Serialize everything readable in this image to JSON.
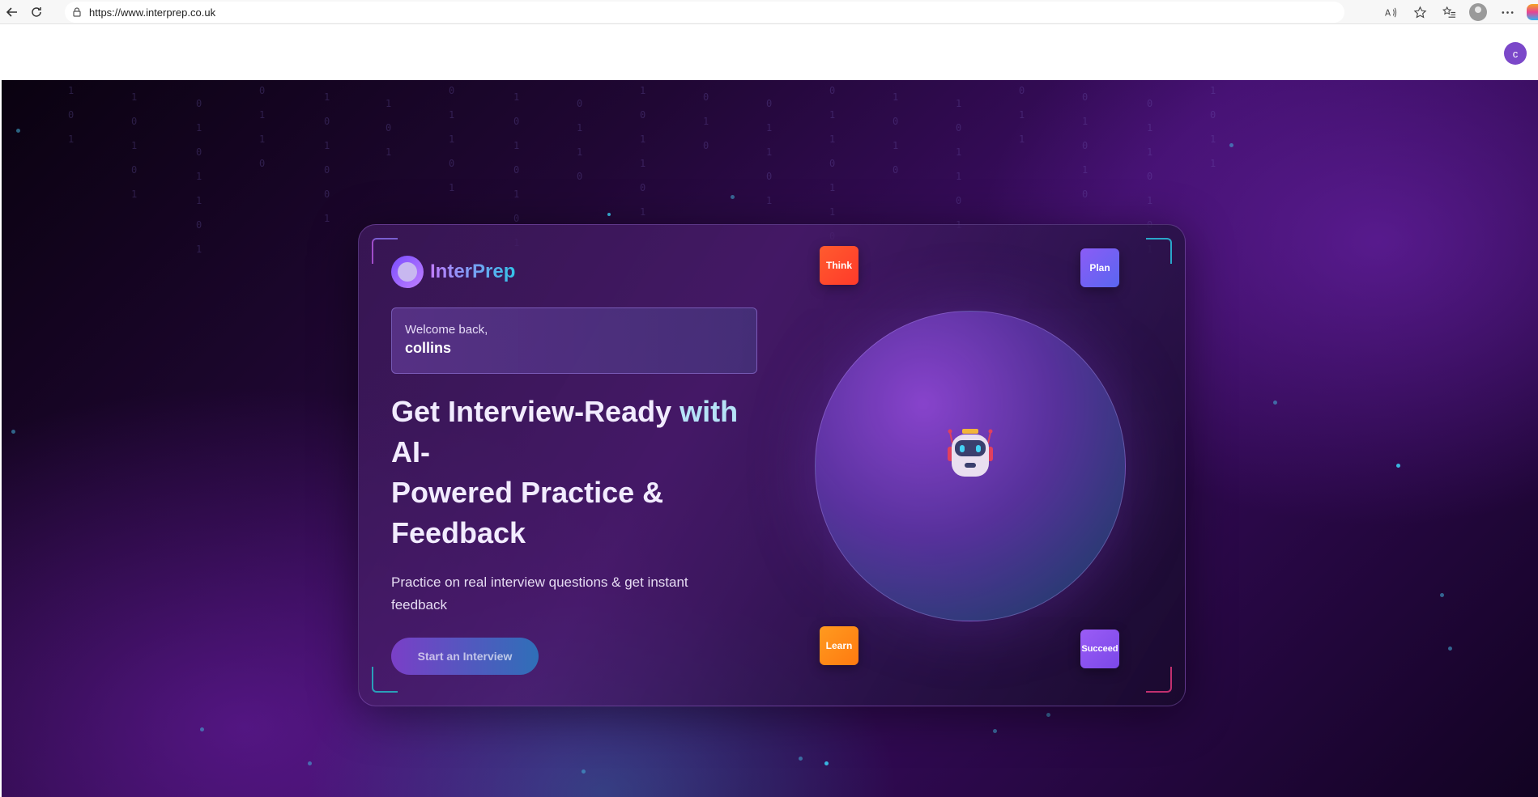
{
  "browser": {
    "url": "https://www.interprep.co.uk",
    "icons": [
      "back-icon",
      "refresh-icon",
      "lock-icon",
      "read-aloud-icon",
      "favorite-star-icon",
      "favorites-list-icon",
      "profile-icon",
      "more-icon",
      "copilot-icon"
    ]
  },
  "header": {
    "avatar_initial": "c"
  },
  "background": {
    "matrix_glyphs": [
      "1",
      "0",
      "1",
      "1",
      "0",
      "1",
      "0",
      "1",
      "0",
      "1",
      "0",
      "1",
      "1",
      "0",
      "1",
      "0",
      "1",
      "1",
      "0",
      "1",
      "0",
      "1",
      "0",
      "0",
      "1",
      "1",
      "0",
      "1",
      "0",
      "1"
    ]
  },
  "card": {
    "brand_name": "InterPrep",
    "welcome_line": "Welcome back,",
    "user_name": "collins",
    "headline_part1": "Get Interview-Ready ",
    "headline_with": "with",
    "headline_part2": "AI-",
    "headline_line2": "Powered Practice &",
    "headline_line3": "Feedback",
    "subtext": "Practice on real interview questions & get instant feedback",
    "cta_label": "Start an Interview",
    "chips": {
      "think": "Think",
      "plan": "Plan",
      "learn": "Learn",
      "succeed": "Succeed"
    }
  },
  "colors": {
    "accent_purple": "#7a3fc7",
    "accent_cyan": "#33c3e8",
    "avatar": "#7b48c9",
    "think": "#ff4a2c",
    "plan": "#7060f2",
    "learn": "#ff8a18",
    "succeed": "#8b52ef"
  }
}
